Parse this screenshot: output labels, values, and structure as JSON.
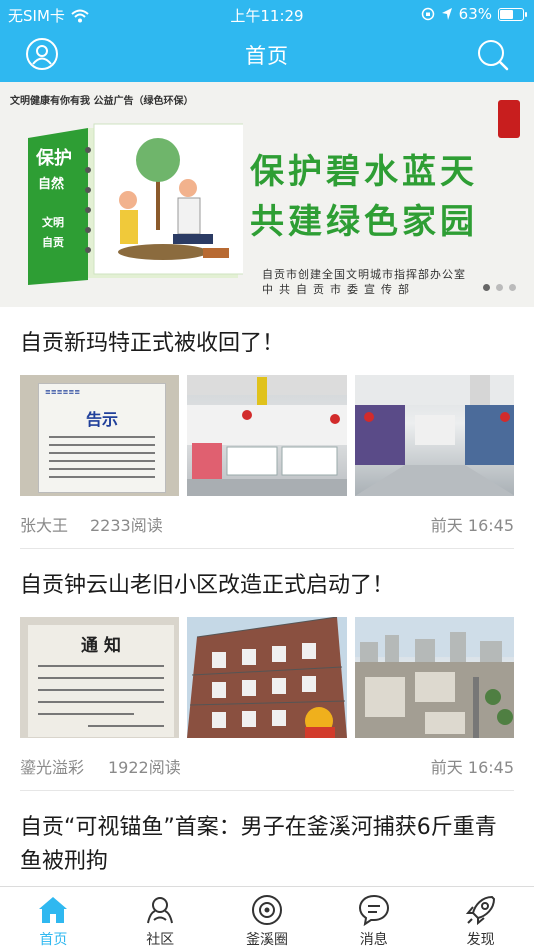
{
  "status_bar": {
    "carrier": "无SIM卡",
    "time": "上午11:29",
    "battery": "63%",
    "battery_level": 0.63
  },
  "header": {
    "title": "首页",
    "user_icon": "user-icon",
    "search_icon": "search-icon"
  },
  "banner": {
    "top_note": "文明健康有你有我   公益广告（绿色环保）",
    "book_text_1": "保护",
    "book_text_2": "自然",
    "book_text_3": "文明",
    "book_text_4": "自贡",
    "slogan_line1": "保护碧水蓝天",
    "slogan_line2": "共建绿色家园",
    "org_line1": "自贡市创建全国文明城市指挥部办公室",
    "org_line2": "中共自贡市委宣传部",
    "slide_count": 3,
    "active_slide": 1,
    "colors": {
      "slogan": "#2e9e34"
    }
  },
  "articles": [
    {
      "headline": "自贡新玛特正式被收回了！",
      "author": "张大王",
      "reads": "2233阅读",
      "time": "前天 16:45",
      "thumbnails": [
        "notice-photo",
        "mall-photo",
        "mall-photo"
      ],
      "notice_title": "告示"
    },
    {
      "headline": "自贡钟云山老旧小区改造正式启动了！",
      "author": "鎏光溢彩",
      "reads": "1922阅读",
      "time": "前天 16:45",
      "thumbnails": [
        "notice-photo",
        "building-photo",
        "building-photo"
      ],
      "notice_title": "通  知"
    },
    {
      "headline": "自贡“可视锚鱼”首案：男子在釜溪河捕获6斤重青鱼被刑拘"
    }
  ],
  "tabbar": {
    "items": [
      {
        "label": "首页",
        "icon": "home-icon",
        "active": true
      },
      {
        "label": "社区",
        "icon": "community-icon",
        "active": false
      },
      {
        "label": "釜溪圈",
        "icon": "circle-icon",
        "active": false
      },
      {
        "label": "消息",
        "icon": "message-icon",
        "active": false
      },
      {
        "label": "发现",
        "icon": "rocket-icon",
        "active": false
      }
    ],
    "colors": {
      "active": "#2fb8f0"
    }
  },
  "colors": {
    "brand": "#2fb8f0"
  }
}
